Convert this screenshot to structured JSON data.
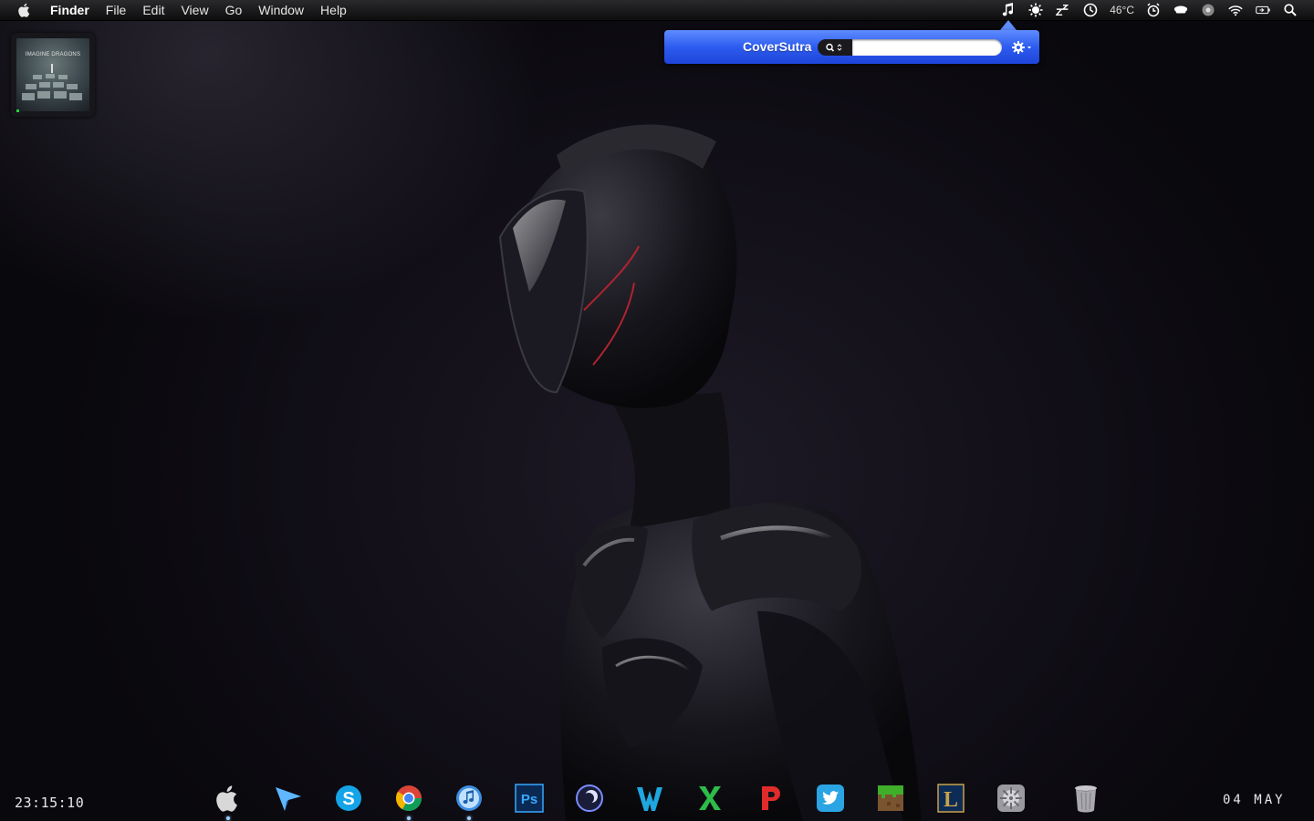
{
  "menubar": {
    "app_name": "Finder",
    "menus": [
      "File",
      "Edit",
      "View",
      "Go",
      "Window",
      "Help"
    ],
    "temperature": "46°C"
  },
  "coversutra": {
    "title": "CoverSutra",
    "search_value": ""
  },
  "album": {
    "art_text": "IMAGINE DRAGONS",
    "progress": 0.04
  },
  "clock": "23:15:10",
  "date": "04 MAY",
  "colors": {
    "panel_blue": "#2d5cf0",
    "progress_green": "#21d33a",
    "running_indicator": "#9ccfff"
  },
  "dock": {
    "items": [
      {
        "name": "finder-icon",
        "label": "",
        "running": true
      },
      {
        "name": "paper-plane-icon",
        "label": "",
        "running": false
      },
      {
        "name": "skype-icon",
        "label": "S",
        "running": false
      },
      {
        "name": "chrome-icon",
        "label": "",
        "running": true
      },
      {
        "name": "itunes-icon",
        "label": "",
        "running": true
      },
      {
        "name": "photoshop-icon",
        "label": "Ps",
        "running": false
      },
      {
        "name": "cinema-icon",
        "label": "",
        "running": false
      },
      {
        "name": "w-app-icon",
        "label": "",
        "running": false
      },
      {
        "name": "x-app-icon",
        "label": "",
        "running": false
      },
      {
        "name": "p-app-icon",
        "label": "",
        "running": false
      },
      {
        "name": "twitter-icon",
        "label": "",
        "running": false
      },
      {
        "name": "minecraft-icon",
        "label": "",
        "running": false
      },
      {
        "name": "league-icon",
        "label": "L",
        "running": false
      },
      {
        "name": "system-preferences-icon",
        "label": "",
        "running": false
      },
      {
        "name": "trash-icon",
        "label": "",
        "running": false
      }
    ]
  }
}
